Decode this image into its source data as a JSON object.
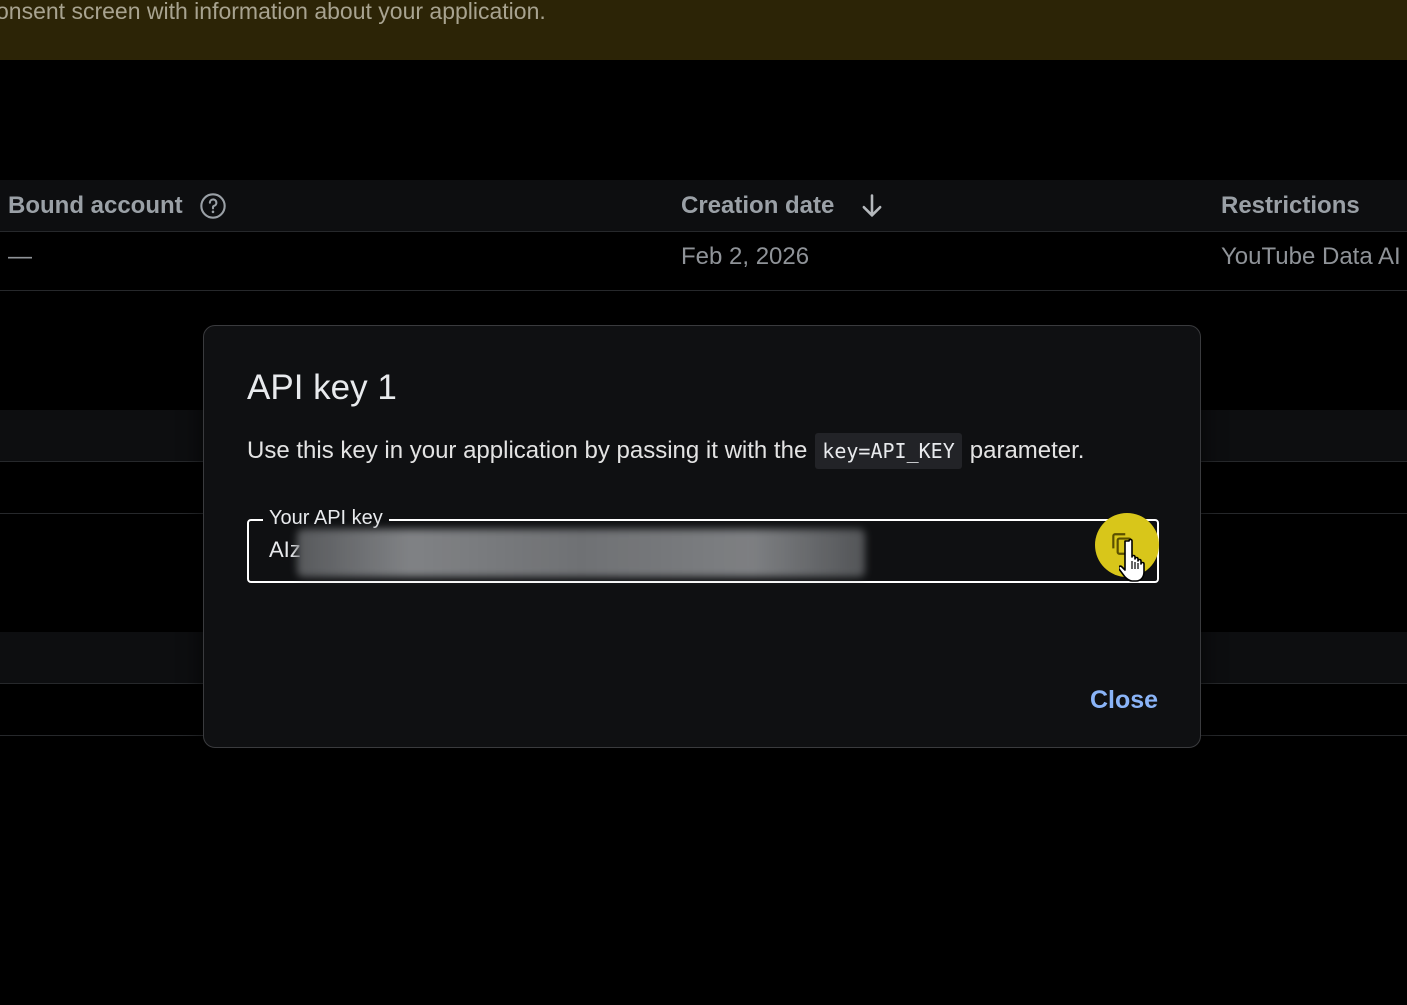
{
  "banner": {
    "text": "onsent screen with information about your application."
  },
  "table": {
    "headers": {
      "bound_account": "Bound account",
      "creation_date": "Creation date",
      "restrictions": "Restrictions"
    },
    "rows": [
      {
        "bound_account": "—",
        "creation_date": "Feb 2, 2026",
        "restrictions": "YouTube Data AI"
      }
    ]
  },
  "dialog": {
    "title": "API key 1",
    "description_before": "Use this key in your application by passing it with the",
    "code": "key=API_KEY",
    "description_after": "parameter.",
    "field_label": "Your API key",
    "field_value_visible": "AIz",
    "close_label": "Close"
  },
  "icons": {
    "help": "help-circle-icon",
    "sort": "arrow-down-icon",
    "copy": "copy-icon",
    "cursor": "hand-pointer-cursor"
  },
  "colors": {
    "accent": "#8ab4f8",
    "banner_bg": "#2c2406",
    "copy_highlight": "#d8c61a"
  }
}
